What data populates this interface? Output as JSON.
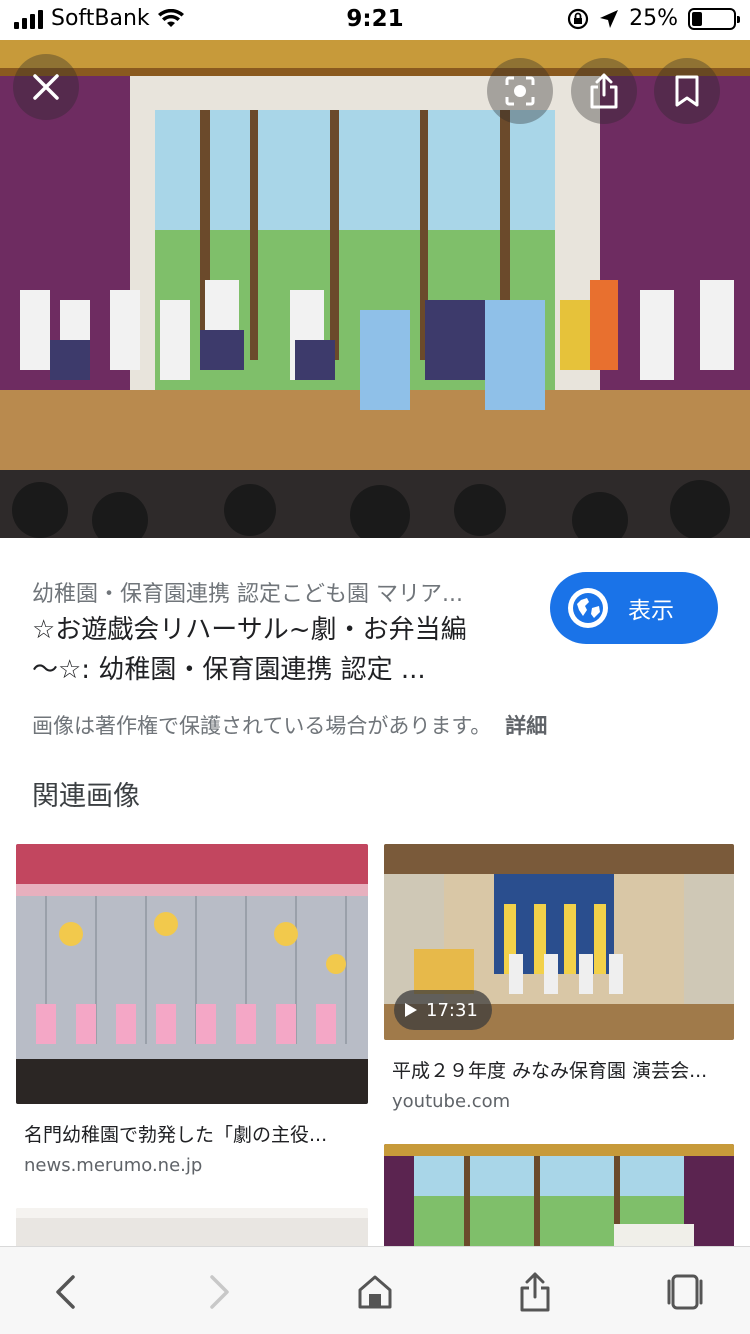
{
  "status_bar": {
    "carrier": "SoftBank",
    "time": "9:21",
    "battery": "25%",
    "battery_level": 0.25
  },
  "hero": {
    "close_icon": "close-icon",
    "lens_icon": "lens-search-icon",
    "share_icon": "share-icon",
    "bookmark_icon": "bookmark-icon"
  },
  "result": {
    "source": "幼稚園・保育園連携 認定こども園 マリア...",
    "title_line1": "☆お遊戯会リハーサル~劇・お弁当編",
    "title_line2": "～☆: 幼稚園・保育園連携 認定 ...",
    "visit_label": "表示",
    "copyright": "画像は著作権で保護されている場合があります。",
    "details": "詳細"
  },
  "related": {
    "heading": "関連画像",
    "items": [
      {
        "caption": "名門幼稚園で勃発した「劇の主役...",
        "domain": "news.merumo.ne.jp"
      },
      {
        "caption": "平成２９年度 みなみ保育園 演芸会...",
        "domain": "youtube.com",
        "duration": "17:31"
      }
    ]
  },
  "colors": {
    "accent": "#1a73e8",
    "curtain": "#6b2b58"
  }
}
